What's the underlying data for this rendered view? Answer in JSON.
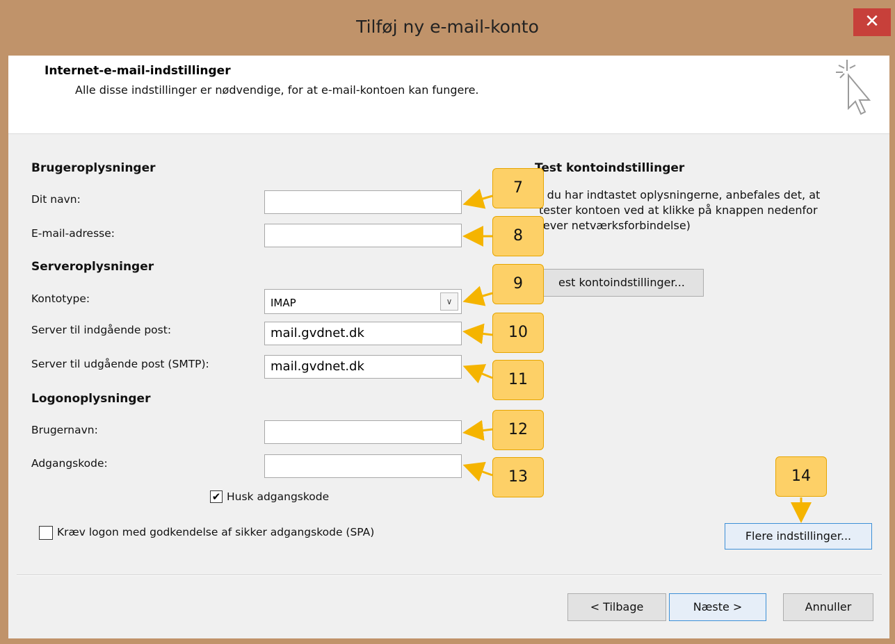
{
  "window": {
    "title": "Tilføj ny e-mail-konto",
    "close_glyph": "✕"
  },
  "header": {
    "title": "Internet-e-mail-indstillinger",
    "subtitle": "Alle disse indstillinger er nødvendige, for at e-mail-kontoen kan fungere.",
    "icon": "cursor-sparkle-icon"
  },
  "user_info": {
    "heading": "Brugeroplysninger",
    "name_label": "Dit navn:",
    "name_value": "",
    "email_label": "E-mail-adresse:",
    "email_value": ""
  },
  "server_info": {
    "heading": "Serveroplysninger",
    "account_type_label": "Kontotype:",
    "account_type_value": "IMAP",
    "incoming_label": "Server til indgående post:",
    "incoming_value": "mail.gvdnet.dk",
    "outgoing_label": "Server til udgående post (SMTP):",
    "outgoing_value": "mail.gvdnet.dk"
  },
  "logon_info": {
    "heading": "Logonoplysninger",
    "username_label": "Brugernavn:",
    "username_value": "",
    "password_label": "Adgangskode:",
    "password_value": "",
    "remember_label": "Husk adgangskode",
    "remember_checked": true,
    "spa_label": "Kræv logon med godkendelse af sikker adgangskode (SPA)",
    "spa_checked": false
  },
  "test_settings": {
    "heading": "Test kontoindstillinger",
    "line1": "r du har indtastet oplysningerne, anbefales det, at",
    "line2": "tester kontoen ved at klikke på knappen nedenfor",
    "line3": "æver netværksforbindelse)",
    "button_label": "est kontoindstillinger..."
  },
  "more_settings_button": "Flere indstillinger...",
  "footer": {
    "back": "< Tilbage",
    "next": "Næste >",
    "cancel": "Annuller"
  },
  "callouts": [
    "7",
    "8",
    "9",
    "10",
    "11",
    "12",
    "13",
    "14"
  ],
  "colors": {
    "titlebar": "#c0936a",
    "close": "#c7403a",
    "callout_fill": "#fdd067",
    "callout_border": "#e6a500",
    "arrow": "#f5b400"
  }
}
